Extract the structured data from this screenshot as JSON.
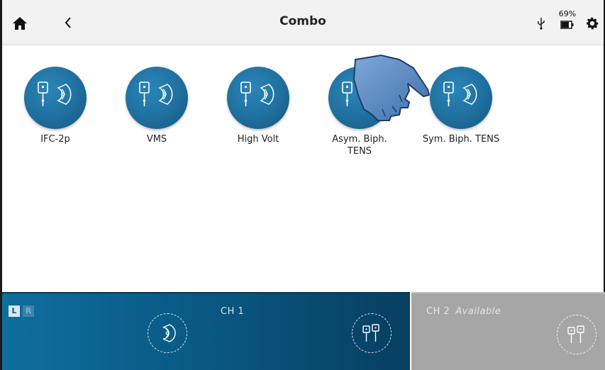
{
  "header": {
    "title": "Combo",
    "battery_percent": "69%",
    "icons": [
      "home-icon",
      "back-icon",
      "usb-icon",
      "battery-icon",
      "gear-icon"
    ]
  },
  "programs": [
    {
      "label": "IFC-2p",
      "icon": "electrode-sensor-icon"
    },
    {
      "label": "VMS",
      "icon": "electrode-sensor-icon"
    },
    {
      "label": "High Volt",
      "icon": "electrode-sensor-icon"
    },
    {
      "label": "Asym. Biph.\nTENS",
      "icon": "electrode-sensor-icon"
    },
    {
      "label": "Sym. Biph. TENS",
      "icon": "electrode-sensor-icon"
    }
  ],
  "channel1": {
    "title": "CH 1",
    "left_label": "L",
    "right_label": "R"
  },
  "channel2": {
    "title": "CH 2",
    "status": "Available"
  },
  "colors": {
    "program_circle": "#1f6f9e",
    "ch1_bar": "#0a5a86",
    "ch2_bar": "#a6a6a6",
    "header_bg": "#f2f2f2"
  }
}
